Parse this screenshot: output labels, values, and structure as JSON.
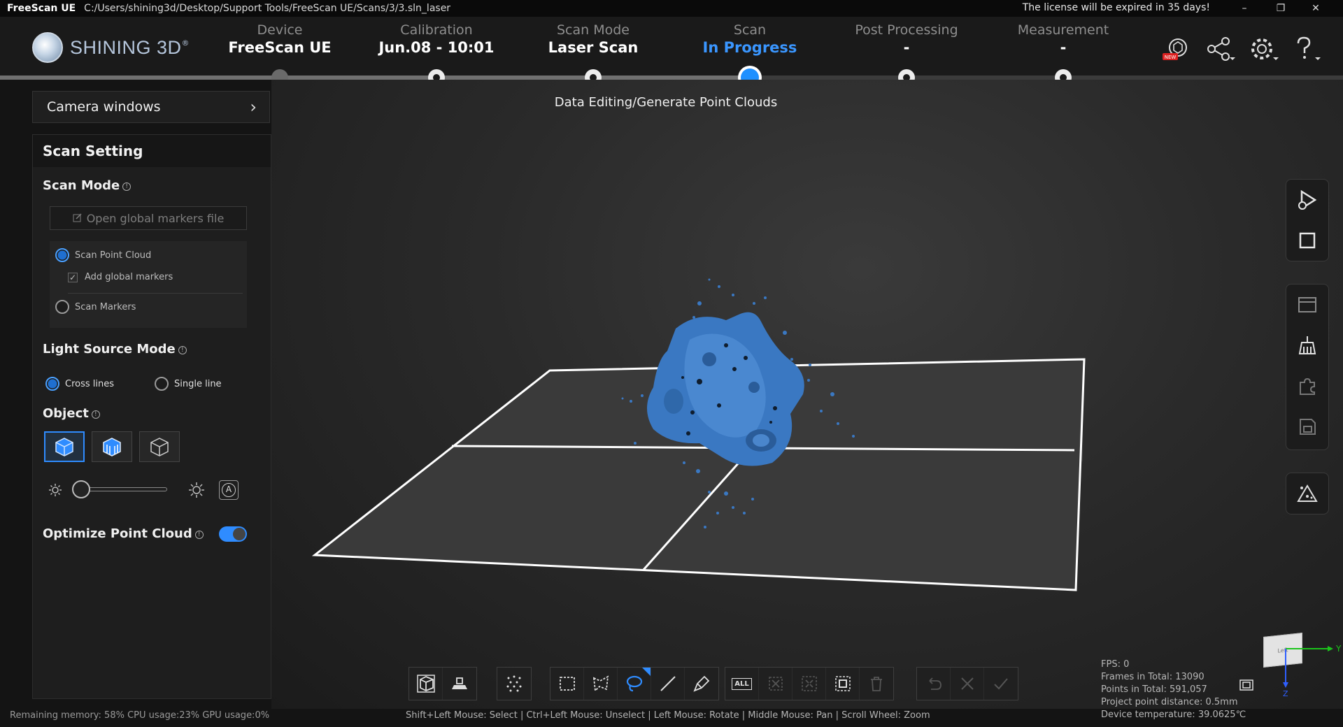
{
  "titlebar": {
    "app_name": "FreeScan UE",
    "path": "C:/Users/shining3d/Desktop/Support Tools/FreeScan UE/Scans/3/3.sln_laser",
    "license": "The license will be expired in 35 days!",
    "minimize": "–",
    "restore": "❐",
    "close": "✕"
  },
  "brand": {
    "logo_text": "SHINING 3D",
    "reg": "®"
  },
  "steps": [
    {
      "label": "Device",
      "value": "FreeScan UE"
    },
    {
      "label": "Calibration",
      "value": "Jun.08 - 10:01"
    },
    {
      "label": "Scan Mode",
      "value": "Laser Scan"
    },
    {
      "label": "Scan",
      "value": "In Progress"
    },
    {
      "label": "Post Processing",
      "value": "-"
    },
    {
      "label": "Measurement",
      "value": "-"
    }
  ],
  "header_icons": {
    "new_badge": "NEW"
  },
  "subcaption": "Data Editing/Generate Point Clouds",
  "left": {
    "camera_windows": "Camera windows",
    "chevron": "›",
    "panel_title": "Scan Setting",
    "scan_mode_title": "Scan Mode",
    "open_markers": "Open global markers file",
    "scan_point_cloud": "Scan Point Cloud",
    "add_global_markers": "Add global markers",
    "scan_markers": "Scan Markers",
    "light_source_title": "Light Source Mode",
    "cross_lines": "Cross lines",
    "single_line": "Single line",
    "object_title": "Object",
    "auto_label": "A",
    "optimize_title": "Optimize Point Cloud",
    "info": "!"
  },
  "hint": "Shift+Left Mouse: Select | Ctrl+Left Mouse: Unselect | Left Mouse: Rotate | Middle Mouse: Pan | Scroll Wheel: Zoom",
  "status": "Remaining memory: 58% CPU usage:23%  GPU usage:0%",
  "stats": {
    "fps": "FPS:  0",
    "frames": "Frames in Total: 13090",
    "points": "Points in Total: 591,057",
    "distance": "Project point distance: 0.5mm",
    "temp": "Device temperature: 39.0625℃"
  },
  "gizmo": {
    "y": "Y",
    "z": "Z",
    "cube_face": "Left"
  },
  "bottom_all": "ALL",
  "colors": {
    "accent": "#1e90ff",
    "model": "#3a78c2"
  }
}
